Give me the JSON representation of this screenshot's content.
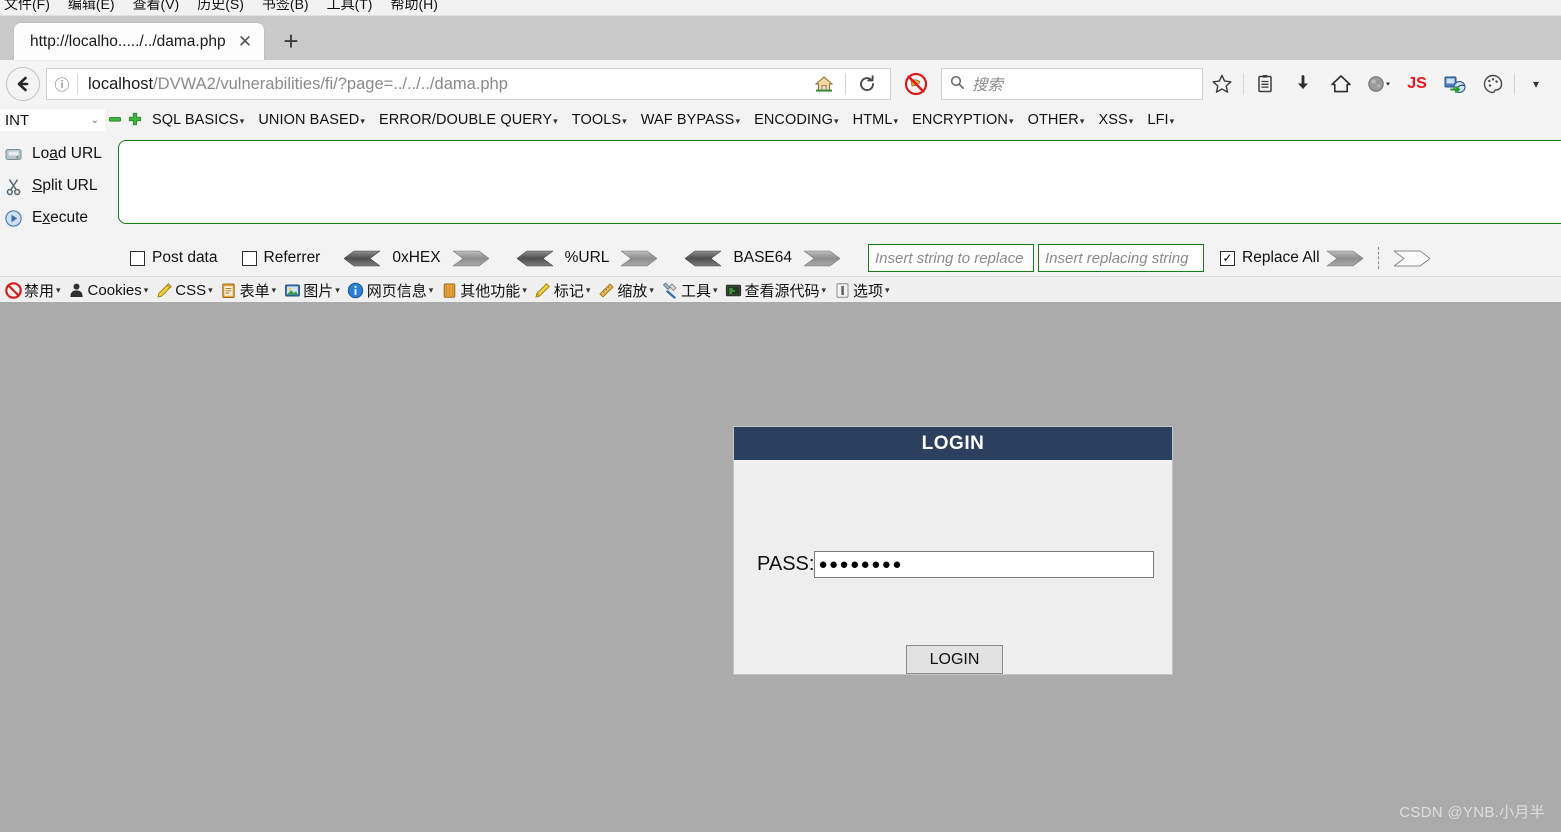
{
  "browser": {
    "menubar": [
      {
        "label": "文件(F)",
        "accel": "F"
      },
      {
        "label": "编辑(E)",
        "accel": "E"
      },
      {
        "label": "查看(V)",
        "accel": "V"
      },
      {
        "label": "历史(S)",
        "accel": "S"
      },
      {
        "label": "书签(B)",
        "accel": "B"
      },
      {
        "label": "工具(T)",
        "accel": "T"
      },
      {
        "label": "帮助(H)",
        "accel": "H"
      }
    ],
    "tab": {
      "title": "http://localho...../../dama.php",
      "close_label": "✕",
      "newtab_label": "+"
    },
    "nav": {
      "back_icon": "back-arrow-icon",
      "info_icon": "ⓘ",
      "url_host": "localhost",
      "url_path": "/DVWA2/vulnerabilities/fi/?page=../../../dama.php",
      "url_full": "localhost/DVWA2/vulnerabilities/fi/?page=../../../dama.php",
      "home_icon": "home-icon",
      "reload_icon": "↻",
      "noscript_icon": "noscript-blocked-icon",
      "search_placeholder": "搜索",
      "search_icon": "search-icon",
      "bookmark_star_icon": "star-icon",
      "reader_list_icon": "reading-list-icon",
      "downloads_icon": "download-arrow-icon",
      "home_button_icon": "home-icon",
      "globe_icon": "globe-icon",
      "js_icon": "JS",
      "proxy_icon": "proxy-switch-icon",
      "cookie_icon": "cookie-palette-icon",
      "overflow_icon": "▾"
    }
  },
  "hackbar": {
    "select_value": "INT",
    "select_chevron": "⌄",
    "minus_icon": "minus-icon",
    "plus_icon": "plus-icon",
    "menus": [
      "SQL BASICS",
      "UNION BASED",
      "ERROR/DOUBLE QUERY",
      "TOOLS",
      "WAF BYPASS",
      "ENCODING",
      "HTML",
      "ENCRYPTION",
      "OTHER",
      "XSS",
      "LFI"
    ],
    "menu_caret": "▾",
    "actions": [
      {
        "label": "Load URL",
        "pre": "Lo",
        "accel": "a",
        "post": "d URL",
        "icon": "load-url-icon"
      },
      {
        "label": "Split URL",
        "pre": "",
        "accel": "S",
        "post": "plit URL",
        "icon": "split-url-icon"
      },
      {
        "label": "Execute",
        "pre": "E",
        "accel": "x",
        "post": "ecute",
        "icon": "execute-icon"
      }
    ],
    "textarea_value": "",
    "options": {
      "post_data_label": "Post data",
      "post_data_checked": false,
      "referrer_label": "Referrer",
      "referrer_checked": false,
      "converters": [
        "0xHEX",
        "%URL",
        "BASE64"
      ],
      "replace_from_placeholder": "Insert string to replace",
      "replace_from_value": "",
      "replace_to_placeholder": "Insert replacing string",
      "replace_to_value": "",
      "replace_all_label": "Replace All",
      "replace_all_checked": true
    }
  },
  "bookmarkbar": {
    "items": [
      {
        "label": "禁用",
        "icon": "disable-icon"
      },
      {
        "label": "Cookies",
        "icon": "cookies-icon"
      },
      {
        "label": "CSS",
        "icon": "css-icon"
      },
      {
        "label": "表单",
        "icon": "forms-icon"
      },
      {
        "label": "图片",
        "icon": "images-icon"
      },
      {
        "label": "网页信息",
        "icon": "page-info-icon"
      },
      {
        "label": "其他功能",
        "icon": "misc-icon"
      },
      {
        "label": "标记",
        "icon": "outline-icon"
      },
      {
        "label": "缩放",
        "icon": "resize-icon"
      },
      {
        "label": "工具",
        "icon": "tools-icon"
      },
      {
        "label": "查看源代码",
        "icon": "view-source-icon"
      },
      {
        "label": "选项",
        "icon": "options-icon"
      }
    ],
    "caret": "▾"
  },
  "page": {
    "login": {
      "header": "LOGIN",
      "pass_label": "PASS:",
      "pass_value": "●●●●●●●●",
      "submit_label": "LOGIN"
    },
    "watermark": "CSDN @YNB.小月半"
  },
  "colors": {
    "page_bg": "#ababab",
    "login_header": "#2b3f5f",
    "login_body": "#efefef",
    "hackbar_green": "#167d16",
    "js_red": "#e8151b"
  }
}
